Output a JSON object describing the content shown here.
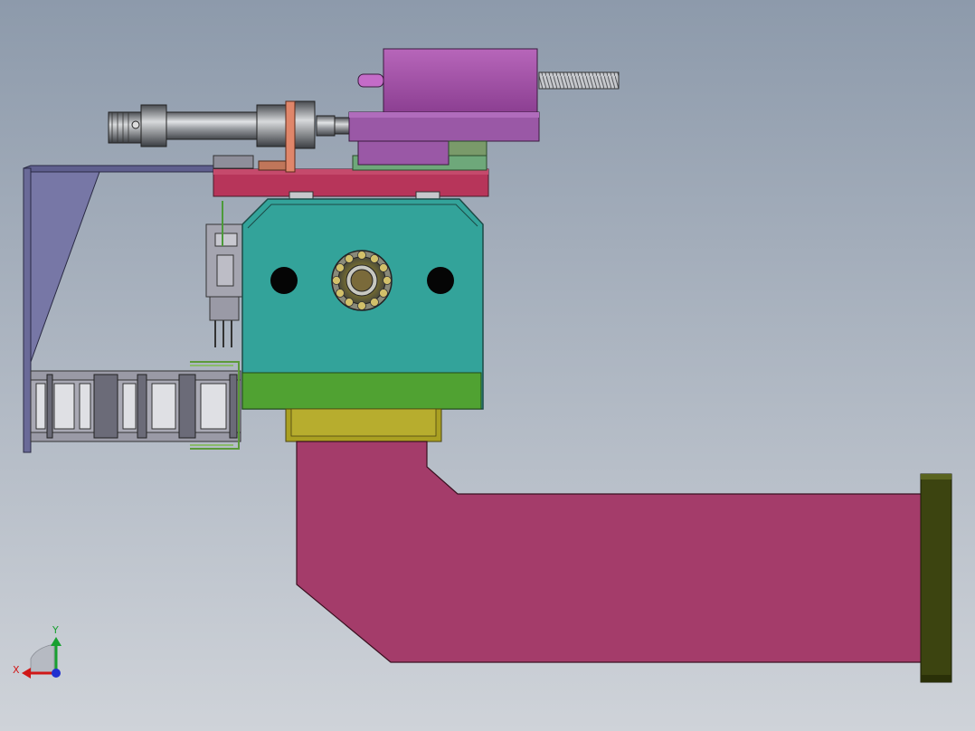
{
  "viewport": {
    "background_top": "#8d9aab",
    "background_bottom": "#cfd3d9"
  },
  "triad": {
    "x_label": "X",
    "y_label": "Y",
    "x_color": "#d01818",
    "y_color": "#18a030",
    "z_color": "#2030d0"
  },
  "palette": {
    "bracket": "#7777a6",
    "base_plate": "#b7355a",
    "body_block": "#33a39a",
    "lower_block": "#50a232",
    "olive_block": "#aaa022",
    "lower_arm": "#a43c6a",
    "end_plate": "#3c4410",
    "solenoid": "#a04ea4",
    "cylinder": "#8f9296",
    "cable_chain": "#6d6d78"
  }
}
